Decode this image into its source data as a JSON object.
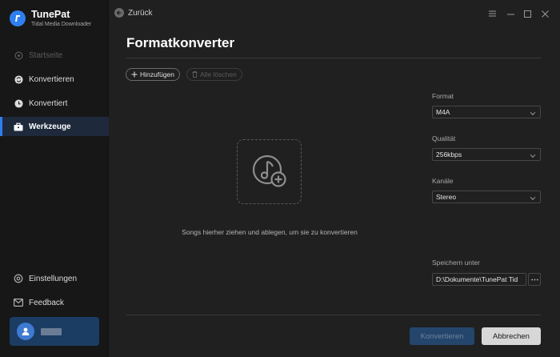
{
  "app": {
    "name": "TunePat",
    "subtitle": "Tidal Media Downloader"
  },
  "sidebar": {
    "items": [
      {
        "label": "Startseite",
        "icon": "home-icon",
        "state": "disabled"
      },
      {
        "label": "Konvertieren",
        "icon": "convert-icon",
        "state": "normal"
      },
      {
        "label": "Konvertiert",
        "icon": "clock-icon",
        "state": "normal"
      },
      {
        "label": "Werkzeuge",
        "icon": "toolbox-icon",
        "state": "active"
      }
    ],
    "bottom": [
      {
        "label": "Einstellungen",
        "icon": "gear-icon"
      },
      {
        "label": "Feedback",
        "icon": "mail-icon"
      }
    ]
  },
  "topbar": {
    "back_label": "Zurück"
  },
  "page": {
    "title": "Formatkonverter"
  },
  "toolbar": {
    "add_label": "Hinzufügen",
    "clear_label": "Alle löschen"
  },
  "dropzone": {
    "hint": "Songs hierher ziehen und ablegen, um sie zu konvertieren"
  },
  "settings": {
    "format_label": "Format",
    "format_value": "M4A",
    "quality_label": "Qualität",
    "quality_value": "256kbps",
    "channels_label": "Kanäle",
    "channels_value": "Stereo",
    "save_label": "Speichern unter",
    "save_path": "D:\\Dokumente\\TunePat Tid"
  },
  "actions": {
    "convert_label": "Konvertieren",
    "cancel_label": "Abbrechen"
  },
  "colors": {
    "accent": "#2f7ff0",
    "background": "#202020",
    "sidebar": "#171717"
  }
}
